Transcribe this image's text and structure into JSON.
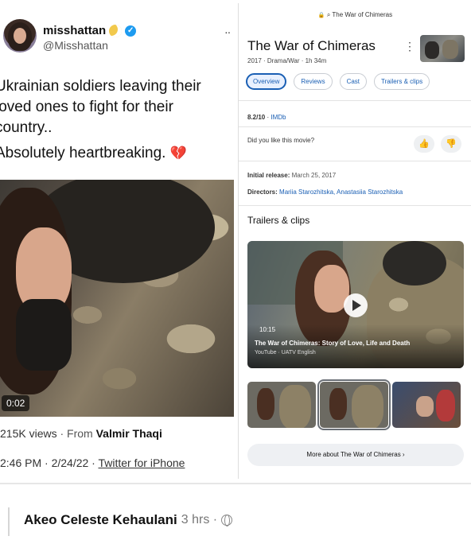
{
  "tweet": {
    "display_name": "misshattan",
    "handle": "@Misshattan",
    "more": "··",
    "lines": [
      "Ukrainian soldiers leaving their",
      "loved ones to fight for their",
      "country.."
    ],
    "line2": "Absolutely heartbreaking.",
    "heart": "💔",
    "video_time": "0:02",
    "views": "215K views",
    "from_label": "From",
    "from_name": "Valmir Thaqi",
    "timestamp": "2:46 PM · 2/24/22 ·",
    "app": "Twitter for iPhone"
  },
  "panel": {
    "url": "The War of Chimeras",
    "title": "The War of Chimeras",
    "subtitle": "2017 · Drama/War · 1h 34m",
    "tabs": [
      {
        "label": "Overview",
        "active": true
      },
      {
        "label": "Reviews"
      },
      {
        "label": "Cast"
      },
      {
        "label": "Trailers & clips"
      }
    ],
    "rating": "8.2/10",
    "rating_source": "IMDb",
    "like_question": "Did you like this movie?",
    "release_label": "Initial release:",
    "release_value": "March 25, 2017",
    "directors_label": "Directors:",
    "directors_value": "Mariia Starozhitska, Anastasiia Starozhitska",
    "trailers_title": "Trailers & clips",
    "video": {
      "duration": "10:15",
      "title": "The War of Chimeras: Story of Love, Life and Death",
      "source": "YouTube · UATV English"
    },
    "more_button": "More about The War of Chimeras  ›"
  },
  "comment": {
    "name": "Akeo Celeste Kehaulani",
    "time": "3 hrs ·"
  },
  "colors": {
    "link_blue": "#1a5fb4",
    "verified_blue": "#1d9bf0"
  }
}
